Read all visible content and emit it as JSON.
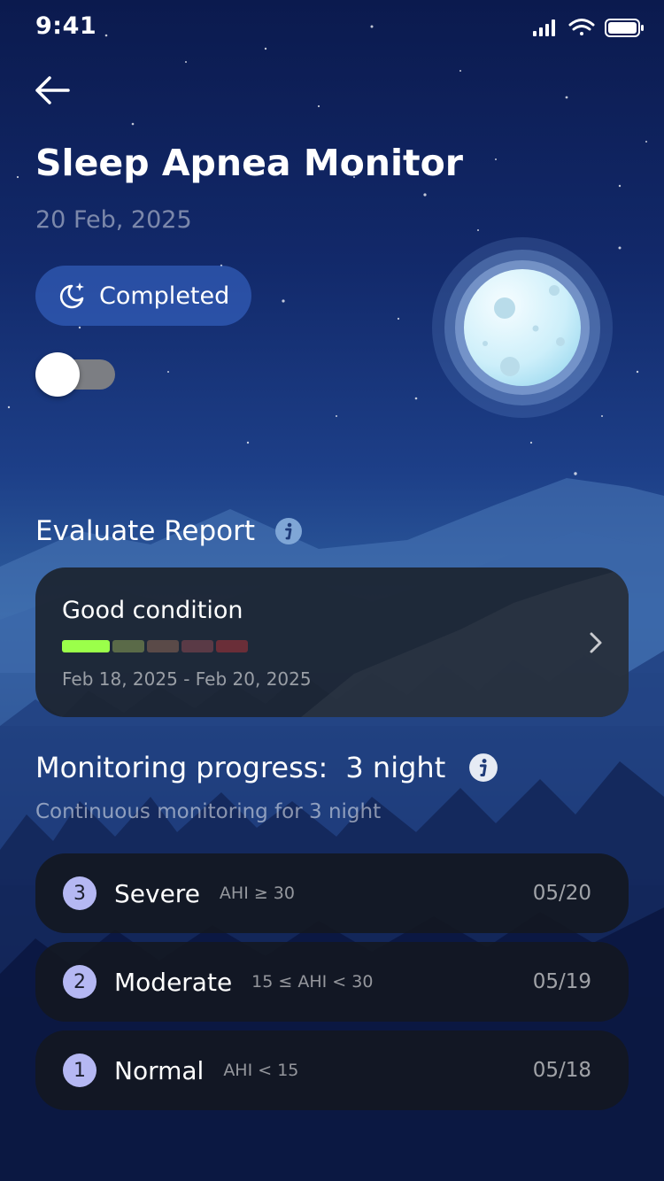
{
  "status_bar": {
    "time": "9:41",
    "icons": [
      "signal-icon",
      "wifi-icon",
      "battery-icon"
    ]
  },
  "header": {
    "back_icon": "back-arrow-icon",
    "title": "Sleep Apnea Monitor",
    "date": "20 Feb, 2025"
  },
  "status_pill": {
    "icon": "moon-star-icon",
    "label": "Completed"
  },
  "toggle": {
    "state": "off"
  },
  "evaluate_report": {
    "title": "Evaluate Report",
    "info_icon": "info-icon",
    "card": {
      "status": "Good condition",
      "range": "Feb 18, 2025 - Feb 20, 2025",
      "scale_colors": [
        "#9bff4a",
        "#5a6a48",
        "#5a4a48",
        "#5a3a46",
        "#6a2e38"
      ],
      "active_level": 0,
      "chevron_icon": "chevron-right-icon"
    }
  },
  "monitoring": {
    "title": "Monitoring progress:",
    "nights": "3 night",
    "info_icon": "info-icon",
    "subtitle": "Continuous monitoring for 3 night",
    "rows": [
      {
        "number": "3",
        "label": "Severe",
        "range": "AHI ≥ 30",
        "date": "05/20"
      },
      {
        "number": "2",
        "label": "Moderate",
        "range": "15 ≤ AHI < 30",
        "date": "05/19"
      },
      {
        "number": "1",
        "label": "Normal",
        "range": "AHI < 15",
        "date": "05/18"
      }
    ]
  },
  "colors": {
    "background_top": "#0b1a4e",
    "background_mid": "#2f5f9f",
    "pill_bg": "#3c6ed2",
    "card_bg": "#1c2430",
    "badge_bg": "#b5b8f3",
    "good": "#9bff4a"
  }
}
